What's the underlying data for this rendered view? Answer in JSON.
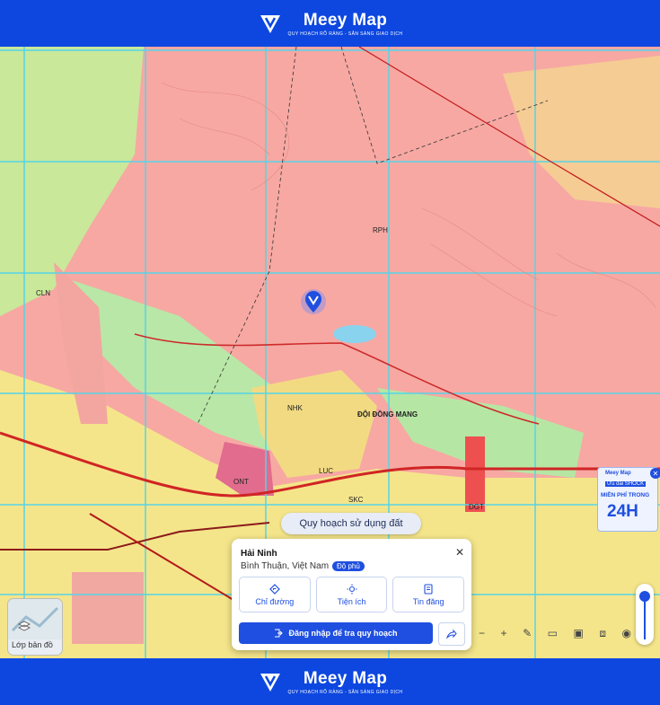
{
  "brand": {
    "name": "Meey Map",
    "tagline": "QUY HOẠCH RÕ RÀNG - SẴN SÀNG GIAO DỊCH"
  },
  "map": {
    "labels": [
      {
        "text": "ĐỘI ĐỒNG MANG",
        "id": "place"
      },
      {
        "text": "CLN",
        "id": "a"
      },
      {
        "text": "LUC",
        "id": "b"
      },
      {
        "text": "ONT",
        "id": "c"
      },
      {
        "text": "RPH",
        "id": "d"
      },
      {
        "text": "NHK",
        "id": "e"
      },
      {
        "text": "SKC",
        "id": "f"
      },
      {
        "text": "DGT",
        "id": "g"
      }
    ]
  },
  "layer_pill": "Quy hoạch sử dụng đất",
  "info_card": {
    "title": "Hải Ninh",
    "subtitle": "Bình Thuận, Việt Nam",
    "badge": "Độ phủ",
    "actions": [
      {
        "label": "Chỉ đường",
        "icon": "directions-icon"
      },
      {
        "label": "Tiện ích",
        "icon": "utilities-icon"
      },
      {
        "label": "Tin đăng",
        "icon": "listing-icon"
      }
    ],
    "login_label": "Đăng nhập để tra quy hoạch"
  },
  "layer_button": {
    "label": "Lớp bản đồ"
  },
  "ad": {
    "brand": "Meey Map",
    "promo": "Ưu đãi SHOCK",
    "headline": "MIỄN PHÍ TRONG",
    "big": "24H"
  },
  "toolbar": [
    "−",
    "+",
    "✎",
    "▭",
    "▣",
    "⧈",
    "◉"
  ],
  "colors": {
    "accent": "#1f4fe0",
    "bar": "#0d47e0"
  }
}
